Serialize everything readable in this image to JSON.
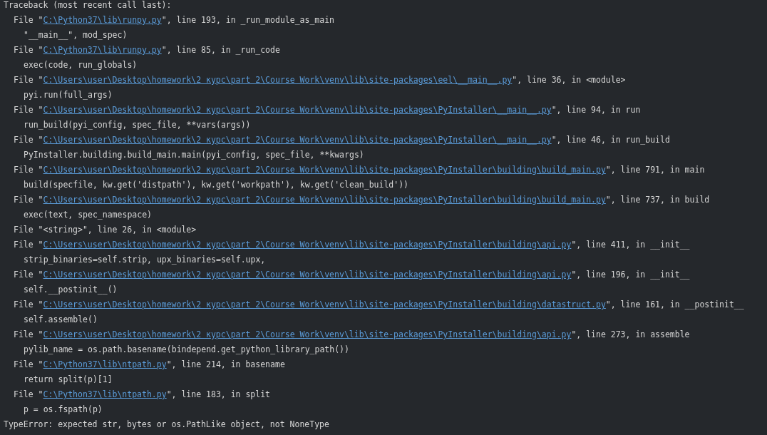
{
  "console": {
    "header": "Traceback (most recent call last):",
    "frames": [
      {
        "kind": "link",
        "lead": "File \"",
        "link": "C:\\Python37\\lib\\runpy.py",
        "tail": "\", line 193, in _run_module_as_main",
        "code": "\"__main__\", mod_spec)"
      },
      {
        "kind": "link",
        "lead": "File \"",
        "link": "C:\\Python37\\lib\\runpy.py",
        "tail": "\", line 85, in _run_code",
        "code": "exec(code, run_globals)"
      },
      {
        "kind": "link",
        "lead": "File \"",
        "link": "C:\\Users\\user\\Desktop\\homework\\2 курс\\part 2\\Course Work\\venv\\lib\\site-packages\\eel\\__main__.py",
        "tail": "\", line 36, in <module>",
        "code": "pyi.run(full_args)"
      },
      {
        "kind": "link",
        "lead": "File \"",
        "link": "C:\\Users\\user\\Desktop\\homework\\2 курс\\part 2\\Course Work\\venv\\lib\\site-packages\\PyInstaller\\__main__.py",
        "tail": "\", line 94, in run",
        "code": "run_build(pyi_config, spec_file, **vars(args))"
      },
      {
        "kind": "link",
        "lead": "File \"",
        "link": "C:\\Users\\user\\Desktop\\homework\\2 курс\\part 2\\Course Work\\venv\\lib\\site-packages\\PyInstaller\\__main__.py",
        "tail": "\", line 46, in run_build",
        "code": "PyInstaller.building.build_main.main(pyi_config, spec_file, **kwargs)"
      },
      {
        "kind": "link",
        "lead": "File \"",
        "link": "C:\\Users\\user\\Desktop\\homework\\2 курс\\part 2\\Course Work\\venv\\lib\\site-packages\\PyInstaller\\building\\build_main.py",
        "tail": "\", line 791, in main",
        "code": "build(specfile, kw.get('distpath'), kw.get('workpath'), kw.get('clean_build'))"
      },
      {
        "kind": "link",
        "lead": "File \"",
        "link": "C:\\Users\\user\\Desktop\\homework\\2 курс\\part 2\\Course Work\\venv\\lib\\site-packages\\PyInstaller\\building\\build_main.py",
        "tail": "\", line 737, in build",
        "code": "exec(text, spec_namespace)"
      },
      {
        "kind": "plain",
        "text": "File \"<string>\", line 26, in <module>"
      },
      {
        "kind": "link",
        "lead": "File \"",
        "link": "C:\\Users\\user\\Desktop\\homework\\2 курс\\part 2\\Course Work\\venv\\lib\\site-packages\\PyInstaller\\building\\api.py",
        "tail": "\", line 411, in __init__",
        "code": "strip_binaries=self.strip, upx_binaries=self.upx,"
      },
      {
        "kind": "link",
        "lead": "File \"",
        "link": "C:\\Users\\user\\Desktop\\homework\\2 курс\\part 2\\Course Work\\venv\\lib\\site-packages\\PyInstaller\\building\\api.py",
        "tail": "\", line 196, in __init__",
        "code": "self.__postinit__()"
      },
      {
        "kind": "link",
        "lead": "File \"",
        "link": "C:\\Users\\user\\Desktop\\homework\\2 курс\\part 2\\Course Work\\venv\\lib\\site-packages\\PyInstaller\\building\\datastruct.py",
        "tail": "\", line 161, in __postinit__",
        "code": "self.assemble()"
      },
      {
        "kind": "link",
        "lead": "File \"",
        "link": "C:\\Users\\user\\Desktop\\homework\\2 курс\\part 2\\Course Work\\venv\\lib\\site-packages\\PyInstaller\\building\\api.py",
        "tail": "\", line 273, in assemble",
        "code": "pylib_name = os.path.basename(bindepend.get_python_library_path())"
      },
      {
        "kind": "link",
        "lead": "File \"",
        "link": "C:\\Python37\\lib\\ntpath.py",
        "tail": "\", line 214, in basename",
        "code": "return split(p)[1]"
      },
      {
        "kind": "link",
        "lead": "File \"",
        "link": "C:\\Python37\\lib\\ntpath.py",
        "tail": "\", line 183, in split",
        "code": "p = os.fspath(p)"
      }
    ],
    "error": "TypeError: expected str, bytes or os.PathLike object, not NoneType"
  }
}
